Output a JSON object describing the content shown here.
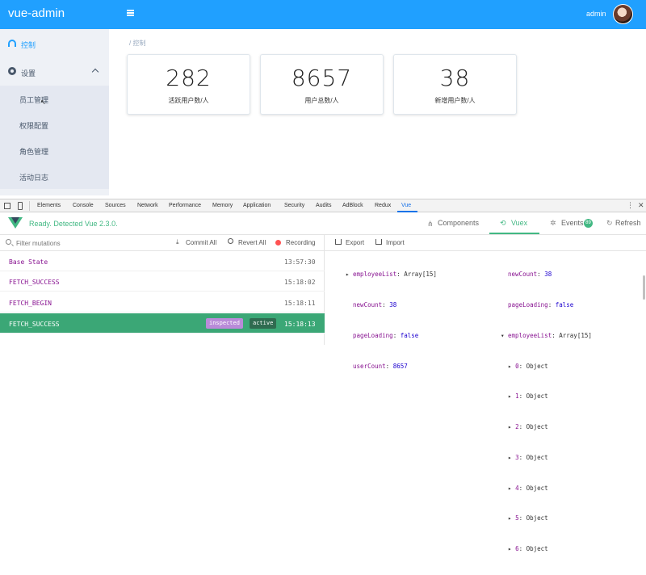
{
  "header": {
    "brand": "vue-admin",
    "username": "admin"
  },
  "sidebar": {
    "items": [
      {
        "label": "控制"
      },
      {
        "label": "设置"
      },
      {
        "label": "员工管理"
      },
      {
        "label": "权限配置"
      },
      {
        "label": "角色管理"
      },
      {
        "label": "活动日志"
      }
    ]
  },
  "main": {
    "breadcrumb_sep": "/",
    "breadcrumb": "控制",
    "cards": [
      {
        "number": "282",
        "caption": "活跃用户数/人"
      },
      {
        "number": "8657",
        "caption": "用户总数/人"
      },
      {
        "number": "38",
        "caption": "新增用户数/人"
      }
    ]
  },
  "devtools": {
    "tabs": [
      "Elements",
      "Console",
      "Sources",
      "Network",
      "Performance",
      "Memory",
      "Application",
      "Security",
      "Audits",
      "AdBlock",
      "Redux",
      "Vue"
    ],
    "active_tab": "Vue"
  },
  "vue": {
    "status": "Ready. Detected Vue 2.3.0.",
    "tabs": {
      "components": "Components",
      "vuex": "Vuex",
      "events": "Events",
      "events_count": "89",
      "refresh": "Refresh"
    },
    "toolbar": {
      "filter_placeholder": "Filter mutations",
      "commit_all": "Commit All",
      "revert_all": "Revert All",
      "recording": "Recording",
      "export": "Export",
      "import": "Import"
    },
    "mutations": [
      {
        "name": "Base State",
        "time": "13:57:30"
      },
      {
        "name": "FETCH_SUCCESS",
        "time": "15:18:02"
      },
      {
        "name": "FETCH_BEGIN",
        "time": "15:18:11"
      },
      {
        "name": "FETCH_SUCCESS",
        "time": "15:18:13",
        "badge_inspected": "inspected",
        "badge_active": "active"
      }
    ],
    "state_left": [
      {
        "arrow": "▸",
        "key": "employeeList",
        "value": "Array[15]"
      },
      {
        "arrow": "",
        "key": "newCount",
        "value": "38"
      },
      {
        "arrow": "",
        "key": "pageLoading",
        "value": "false"
      },
      {
        "arrow": "",
        "key": "userCount",
        "value": "8657"
      }
    ],
    "state_right": [
      {
        "arrow": "",
        "key": "newCount",
        "value": "38"
      },
      {
        "arrow": "",
        "key": "pageLoading",
        "value": "false"
      },
      {
        "arrow": "▾",
        "key": "employeeList",
        "value": "Array[15]"
      },
      {
        "arrow": "▸",
        "key": "0",
        "value": "Object"
      },
      {
        "arrow": "▸",
        "key": "1",
        "value": "Object"
      },
      {
        "arrow": "▸",
        "key": "2",
        "value": "Object"
      },
      {
        "arrow": "▸",
        "key": "3",
        "value": "Object"
      },
      {
        "arrow": "▸",
        "key": "4",
        "value": "Object"
      },
      {
        "arrow": "▸",
        "key": "5",
        "value": "Object"
      },
      {
        "arrow": "▸",
        "key": "6",
        "value": "Object"
      }
    ]
  }
}
